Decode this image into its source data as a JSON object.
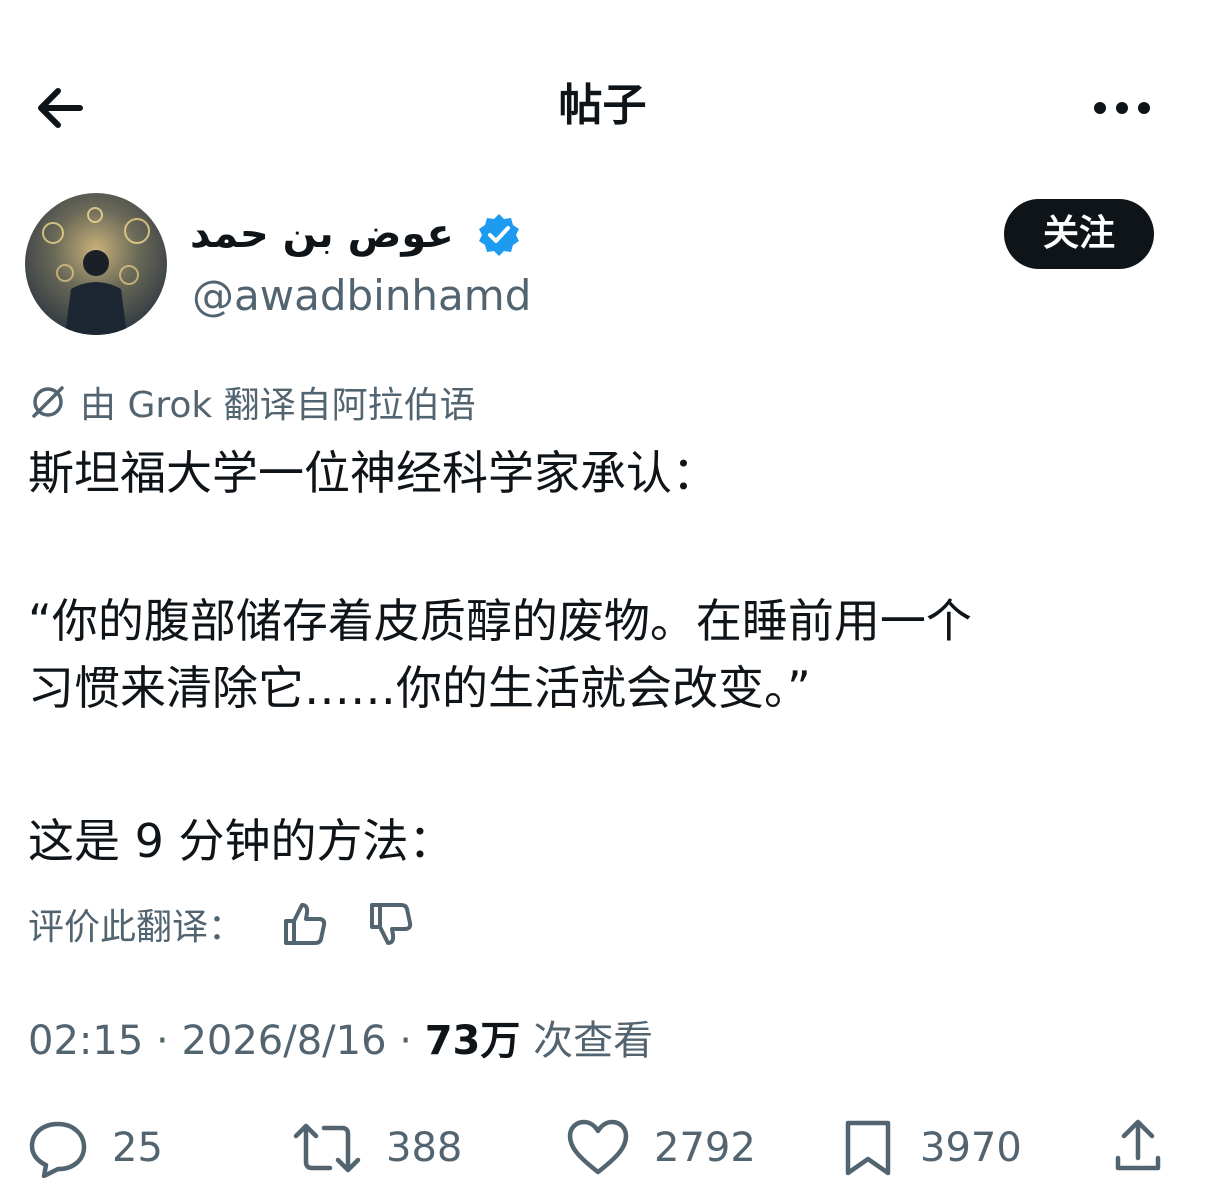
{
  "header": {
    "title": "帖子",
    "back_icon": "arrow-left-icon",
    "more_icon": "more-horizontal-icon"
  },
  "author": {
    "display_name": "عوض بن حمد",
    "handle": "@awadbinhamd",
    "verified": true,
    "follow_label": "关注"
  },
  "translation": {
    "note": "由 Grok 翻译自阿拉伯语"
  },
  "post": {
    "line1": "斯坦福大学一位神经科学家承认：",
    "line2": "“你的腹部储存着皮质醇的废物。在睡前用一个",
    "line3": "习惯来清除它……你的生活就会改变。”",
    "line4": "这是 9 分钟的方法："
  },
  "rating": {
    "label": "评价此翻译：",
    "up_icon": "thumbs-up-icon",
    "down_icon": "thumbs-down-icon"
  },
  "meta": {
    "time": "02:15",
    "date": "2026/8/16",
    "views": "73万",
    "views_label": "次查看",
    "sep": "·"
  },
  "actions": {
    "replies": "25",
    "retweets": "388",
    "likes": "2792",
    "bookmarks": "3970"
  },
  "colors": {
    "accent": "#1d9bf0",
    "text": "#0f1419",
    "secondary": "#536471"
  }
}
